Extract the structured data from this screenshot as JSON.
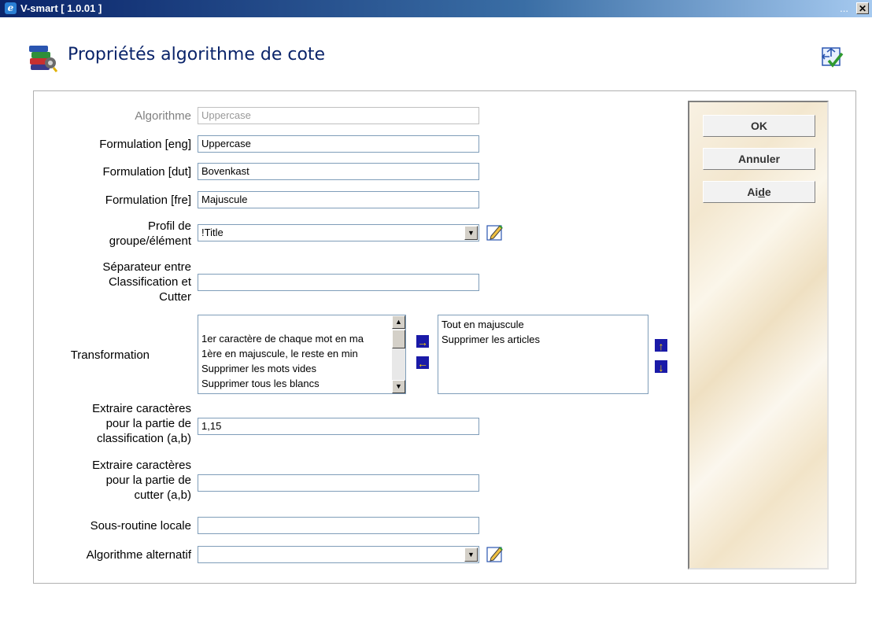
{
  "window": {
    "title": "V-smart [ 1.0.01 ]",
    "menu_dots": "...",
    "close_label": "✕"
  },
  "header": {
    "page_title": "Propriétés algorithme de cote"
  },
  "form": {
    "algorithm": {
      "label": "Algorithme",
      "value": "Uppercase"
    },
    "formulation_eng": {
      "label": "Formulation [eng]",
      "value": "Uppercase"
    },
    "formulation_dut": {
      "label": "Formulation [dut]",
      "value": "Bovenkast"
    },
    "formulation_fre": {
      "label": "Formulation [fre]",
      "value": "Majuscule"
    },
    "profile": {
      "label_line1": "Profil de",
      "label_line2": "groupe/élément",
      "value": "!Title"
    },
    "separator": {
      "label_line1": "Séparateur entre",
      "label_line2": "Classification et",
      "label_line3": "Cutter",
      "value": ""
    },
    "transformation": {
      "label": "Transformation",
      "available": [
        "1er caractère de chaque mot en ma",
        "1ère en majuscule, le reste en min",
        "Supprimer les mots vides",
        "Supprimer tous les blancs"
      ],
      "selected": [
        "Tout en majuscule",
        "Supprimer les articles"
      ]
    },
    "extract_class": {
      "label_line1": "Extraire caractères",
      "label_line2": "pour la partie de",
      "label_line3": "classification (a,b)",
      "value": "1,15"
    },
    "extract_cutter": {
      "label_line1": "Extraire caractères",
      "label_line2": "pour la partie de",
      "label_line3": "cutter (a,b)",
      "value": ""
    },
    "local_subroutine": {
      "label": "Sous-routine locale",
      "value": ""
    },
    "alt_algorithm": {
      "label": "Algorithme alternatif",
      "value": ""
    }
  },
  "buttons": {
    "ok": "OK",
    "cancel": "Annuler",
    "help_pre": "Ai",
    "help_ul": "d",
    "help_post": "e"
  }
}
